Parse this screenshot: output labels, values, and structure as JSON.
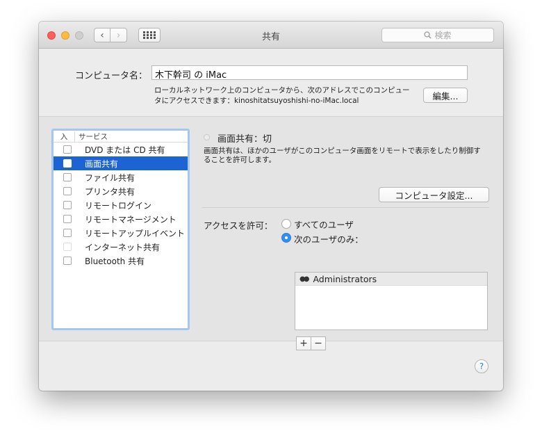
{
  "window": {
    "title": "共有",
    "search_placeholder": "検索"
  },
  "computer": {
    "label": "コンピュータ名：",
    "name": "木下幹司 の iMac",
    "address_desc": "ローカルネットワーク上のコンピュータから、次のアドレスでこのコンピュータにアクセスできます：kinoshitatsuyoshishi-no-iMac.local",
    "edit_button": "編集..."
  },
  "services": {
    "header_on": "入",
    "header_service": "サービス",
    "items": [
      {
        "label": "DVD または CD 共有",
        "checked": false,
        "selected": false
      },
      {
        "label": "画面共有",
        "checked": false,
        "selected": true
      },
      {
        "label": "ファイル共有",
        "checked": false,
        "selected": false
      },
      {
        "label": "プリンタ共有",
        "checked": false,
        "selected": false
      },
      {
        "label": "リモートログイン",
        "checked": false,
        "selected": false
      },
      {
        "label": "リモートマネージメント",
        "checked": false,
        "selected": false
      },
      {
        "label": "リモートアップルイベント",
        "checked": false,
        "selected": false
      },
      {
        "label": "インターネット共有",
        "checked": false,
        "selected": false
      },
      {
        "label": "Bluetooth 共有",
        "checked": false,
        "selected": false
      }
    ]
  },
  "detail": {
    "status": "画面共有：切",
    "description": "画面共有は、ほかのユーザがこのコンピュータ画面をリモートで表示をしたり制御することを許可します。",
    "computer_settings_button": "コンピュータ設定...",
    "access_label": "アクセスを許可：",
    "radio_all": "すべてのユーザ",
    "radio_only": "次のユーザのみ：",
    "selected_radio": "only",
    "users": [
      "Administrators"
    ],
    "add_button": "+",
    "remove_button": "−"
  },
  "help_button": "?",
  "colors": {
    "selection": "#1c64d3",
    "radio_on": "#2f8ff2",
    "focus_ring": "#a5c6ee"
  }
}
